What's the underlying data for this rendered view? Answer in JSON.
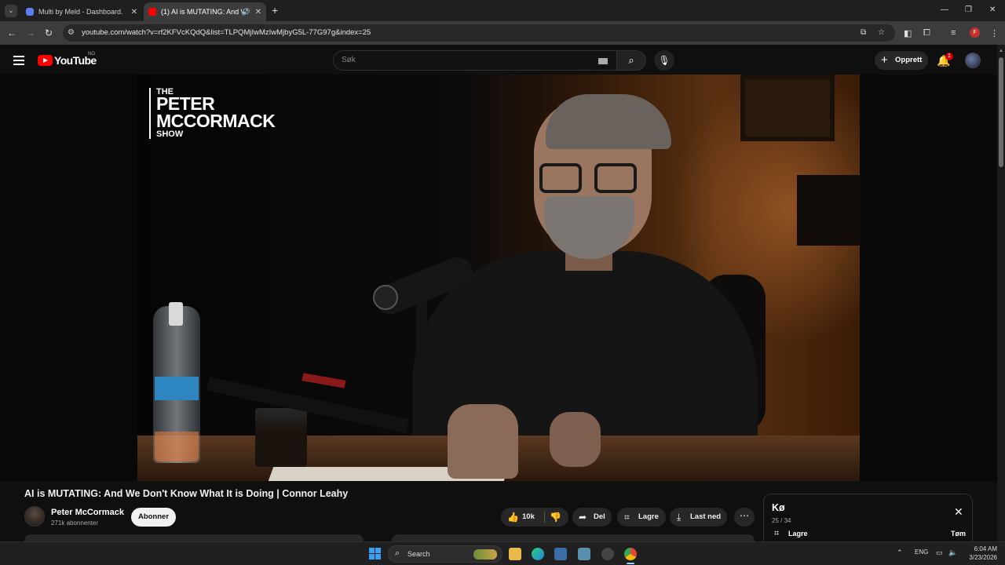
{
  "browser": {
    "tabs": [
      {
        "title": "Multi by Meld - Dashboard.",
        "close": "✕"
      },
      {
        "title": "(1) AI is MUTATING: And W",
        "close": "✕"
      }
    ],
    "new_tab": "+",
    "url": "youtube.com/watch?v=rf2KFVcKQdQ&list=TLPQMjIwMzIwMjbyG5L-77G97g&index=25",
    "profile_initial": "F",
    "window_controls": [
      "—",
      "❐",
      "✕"
    ]
  },
  "youtube": {
    "logo_text": "YouTube",
    "country_code": "NO",
    "search_placeholder": "Søk",
    "create_label": "Opprett",
    "notification_count": "1"
  },
  "video": {
    "show_logo": {
      "line1": "THE",
      "line2": "PETER",
      "line3": "MCCORMACK",
      "line4": "SHOW"
    },
    "title": "AI is MUTATING: And We Don't Know What It is Doing | Connor Leahy"
  },
  "channel": {
    "name": "Peter McCormack",
    "subscribers": "271k abonnenter",
    "subscribe_label": "Abonner"
  },
  "actions": {
    "likes": "10k",
    "share": "Del",
    "save": "Lagre",
    "download": "Last ned",
    "more": "⋯"
  },
  "queue": {
    "title": "Kø",
    "count": "25 / 34",
    "save": "Lagre",
    "clear": "Tøm"
  },
  "taskbar": {
    "search_label": "Search",
    "language": "ENG",
    "time": "6:04 AM",
    "date": "3/23/2026"
  },
  "colors": {
    "accent_red": "#ff0000",
    "background": "#0f0f0f",
    "pill": "#272727"
  }
}
